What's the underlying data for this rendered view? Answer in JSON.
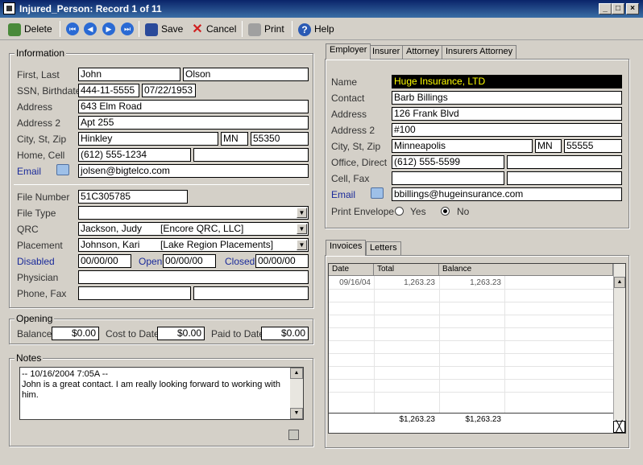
{
  "window": {
    "title": "Injured_Person: Record 1 of 11"
  },
  "toolbar": {
    "delete": "Delete",
    "save": "Save",
    "cancel": "Cancel",
    "print": "Print",
    "help": "Help"
  },
  "info": {
    "legend": "Information",
    "first_last_label": "First, Last",
    "first": "John",
    "last": "Olson",
    "ssn_label": "SSN, Birthdate",
    "ssn": "444-11-5555",
    "birthdate": "07/22/1953",
    "address_label": "Address",
    "address": "643 Elm Road",
    "address2_label": "Address 2",
    "address2": "Apt 255",
    "city_label": "City, St, Zip",
    "city": "Hinkley",
    "state": "MN",
    "zip": "55350",
    "phone_label": "Home, Cell",
    "home": "(612) 555-1234",
    "cell": "",
    "email_label": "Email",
    "email": "jolsen@bigtelco.com",
    "file_number_label": "File Number",
    "file_number": "51C305785",
    "file_type_label": "File Type",
    "file_type": "",
    "qrc_label": "QRC",
    "qrc": "Jackson, Judy",
    "qrc_org": "[Encore QRC, LLC]",
    "placement_label": "Placement",
    "placement": "Johnson, Kari",
    "placement_org": "[Lake Region Placements]",
    "disabled_label": "Disabled",
    "disabled": "00/00/00",
    "open_label": "Open",
    "open": "00/00/00",
    "closed_label": "Closed",
    "closed": "00/00/00",
    "physician_label": "Physician",
    "physician": "",
    "phonefax_label": "Phone, Fax",
    "phone": "",
    "fax": ""
  },
  "opening": {
    "legend": "Opening",
    "balance_label": "Balance",
    "balance": "$0.00",
    "cost_label": "Cost to Date",
    "cost": "$0.00",
    "paid_label": "Paid to Date",
    "paid": "$0.00"
  },
  "notes": {
    "legend": "Notes",
    "line1": "-- 10/16/2004  7:05A --",
    "line2": "John is a great contact.  I am really looking forward to working  with",
    "line3": "him."
  },
  "employer_tabs": [
    "Employer",
    "Insurer",
    "Attorney",
    "Insurers Attorney"
  ],
  "employer": {
    "name_label": "Name",
    "name": "Huge Insurance, LTD",
    "contact_label": "Contact",
    "contact": "Barb Billings",
    "address_label": "Address",
    "address": "126 Frank Blvd",
    "address2_label": "Address 2",
    "address2": "#100",
    "city_label": "City, St, Zip",
    "city": "Minneapolis",
    "state": "MN",
    "zip": "55555",
    "office_label": "Office, Direct",
    "office": "(612) 555-5599",
    "direct": "",
    "cellfax_label": "Cell, Fax",
    "cell": "",
    "fax": "",
    "email_label": "Email",
    "email": "bbillings@hugeinsurance.com",
    "envelope_label": "Print Envelope",
    "yes": "Yes",
    "no": "No"
  },
  "invoice_tabs": [
    "Invoices",
    "Letters"
  ],
  "invoices": {
    "headers": [
      "Date",
      "Total",
      "Balance"
    ],
    "rows": [
      {
        "date": "09/16/04",
        "total": "1,263.23",
        "balance": "1,263.23"
      }
    ],
    "footer_total": "$1,263.23",
    "footer_balance": "$1,263.23"
  },
  "colors": {
    "title_bar": "#0a246a",
    "face": "#d4d0c8",
    "label_link": "#1a2a9a",
    "name_bg": "#000000",
    "name_fg": "#ffff00"
  }
}
